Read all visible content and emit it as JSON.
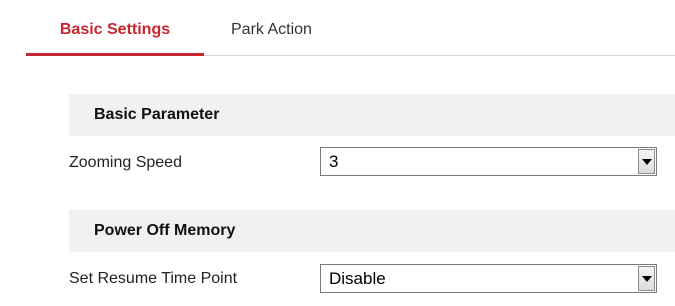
{
  "tabs": [
    {
      "label": "Basic Settings",
      "active": true
    },
    {
      "label": "Park Action",
      "active": false
    }
  ],
  "sections": {
    "basic_parameter": {
      "title": "Basic Parameter",
      "zooming_speed": {
        "label": "Zooming Speed",
        "value": "3"
      }
    },
    "power_off_memory": {
      "title": "Power Off Memory",
      "resume_time": {
        "label": "Set Resume Time Point",
        "value": "Disable"
      }
    }
  },
  "colors": {
    "accent": "#c8262e",
    "section_bg": "#f1f1f1"
  },
  "icons": {
    "dropdown": "chevron-down-icon"
  }
}
